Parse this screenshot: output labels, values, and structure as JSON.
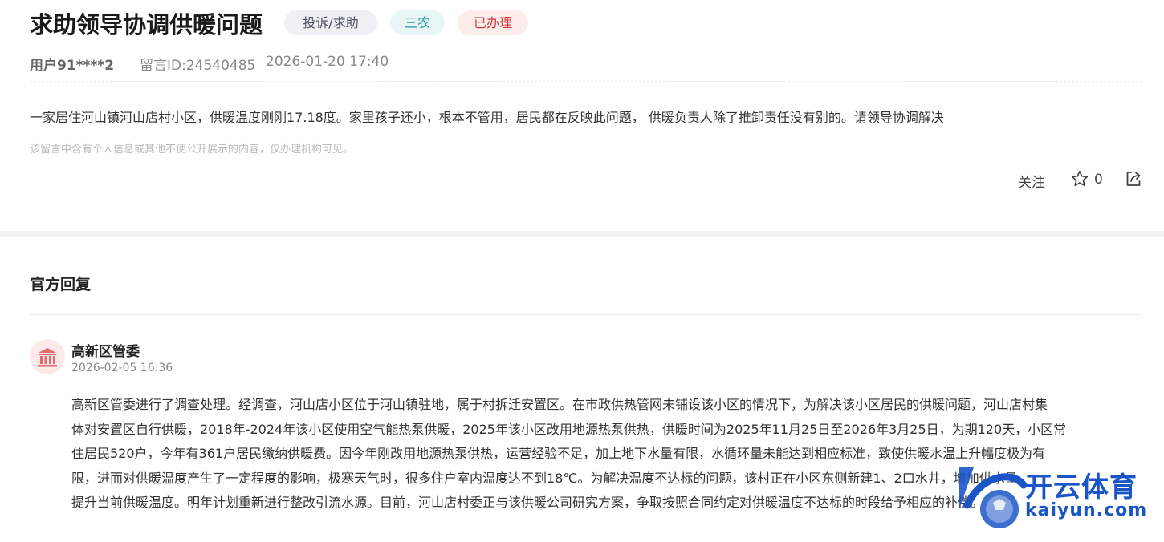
{
  "post": {
    "title": "求助领导协调供暖问题",
    "tags": [
      "投诉/求助",
      "三农",
      "已办理"
    ],
    "user": "用户91****2",
    "message_id": "留言ID:24540485",
    "datetime": "2026-01-20 17:40",
    "content": "一家居住河山镇河山店村小区，供暖温度刚刚17.18度。家里孩子还小，根本不管用，居民都在反映此问题，  供暖负责人除了推卸责任没有别的。请领导协调解决",
    "privacy_note": "该留言中含有个人信息或其他不便公开展示的内容，仅办理机构可见。",
    "follow_label": "关注",
    "star_count": "0"
  },
  "reply": {
    "section_title": "官方回复",
    "department": "高新区管委",
    "datetime": "2026-02-05 16:36",
    "lines": [
      "高新区管委进行了调查处理。经调查，河山店小区位于河山镇驻地，属于村拆迁安置区。在市政供热管网未铺设该小区的情况下，为解决该小区居民的供暖问题，河山店村集",
      "体对安置区自行供暖，2018年-2024年该小区使用空气能热泵供暖，2025年该小区改用地源热泵供热，供暖时间为2025年11月25日至2026年3月25日，为期120天，小区常",
      "住居民520户，今年有361户居民缴纳供暖费。因今年刚改用地源热泵供热，运营经验不足，加上地下水量有限，水循环量未能达到相应标准，致使供暖水温上升幅度极为有",
      "限，进而对供暖温度产生了一定程度的影响，极寒天气时，很多住户室内温度达不到18℃。为解决温度不达标的问题，该村正在小区东侧新建1、2口水井，增加供水量，",
      "提升当前供暖温度。明年计划重新进行整改引流水源。目前，河山店村委正与该供暖公司研究方案，争取按照合同约定对供暖温度不达标的时段给予相应的补偿。"
    ]
  },
  "watermark": {
    "cn": "开云体育",
    "en": "kaiyun.com"
  },
  "icons": [
    "star-icon",
    "share-icon",
    "government-building-icon",
    "kaiyun-logo-icon"
  ],
  "colors": {
    "tag_category_bg": "#eef0f4",
    "tag_farm_text": "#2a9a9a",
    "tag_status_text": "#d0393d",
    "watermark_blue": "#1a55c8"
  }
}
